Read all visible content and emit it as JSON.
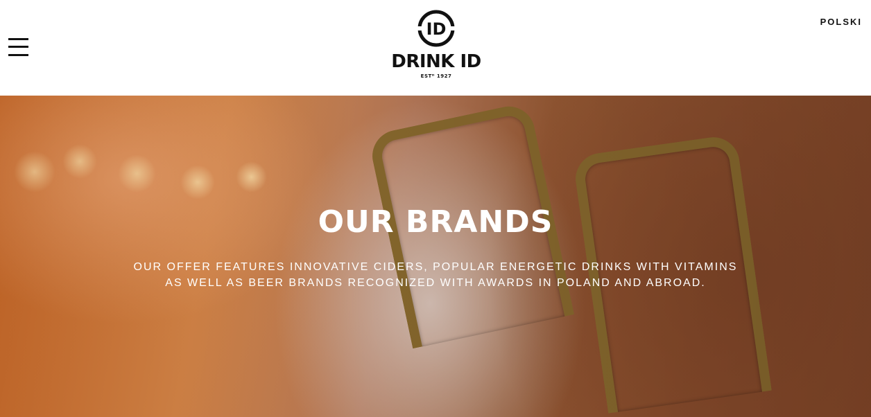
{
  "header": {
    "menu_icon": "hamburger-menu-icon",
    "logo": {
      "mark": "ID",
      "name": "DRINK ID",
      "established": "ESTᴰ 1927"
    },
    "language_label": "POLSKI"
  },
  "hero": {
    "title": "OUR BRANDS",
    "line1": "OUR OFFER FEATURES INNOVATIVE CIDERS, POPULAR ENERGETIC DRINKS WITH VITAMINS",
    "line2": "AS WELL AS BEER BRANDS RECOGNIZED WITH AWARDS IN POLAND AND ABROAD."
  },
  "colors": {
    "header_bg": "#ffffff",
    "text_dark": "#111111",
    "hero_text": "#ffffff"
  }
}
